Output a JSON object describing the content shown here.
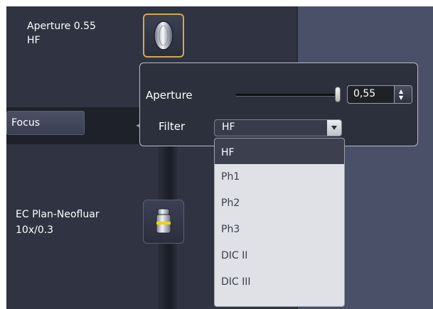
{
  "condenser": {
    "aperture_label": "Aperture 0.55",
    "filter_label": "HF",
    "icon": "condenser-lens-icon"
  },
  "focus": {
    "label": "Focus"
  },
  "objective": {
    "name": "EC Plan-Neofluar",
    "spec": "10x/0.3",
    "icon": "objective-lens-icon"
  },
  "popup": {
    "aperture_label": "Aperture",
    "aperture_value": "0,55",
    "aperture_fraction": 1.0,
    "filter_label": "Filter",
    "filter_selected": "HF"
  },
  "filter_options": [
    "HF",
    "Ph1",
    "Ph2",
    "Ph3",
    "DIC II",
    "DIC III"
  ],
  "colors": {
    "background": "#2f3342",
    "selected_border": "#d4a84c",
    "list_background": "#dfe1e7",
    "selected_item": "#3b3f4e"
  }
}
